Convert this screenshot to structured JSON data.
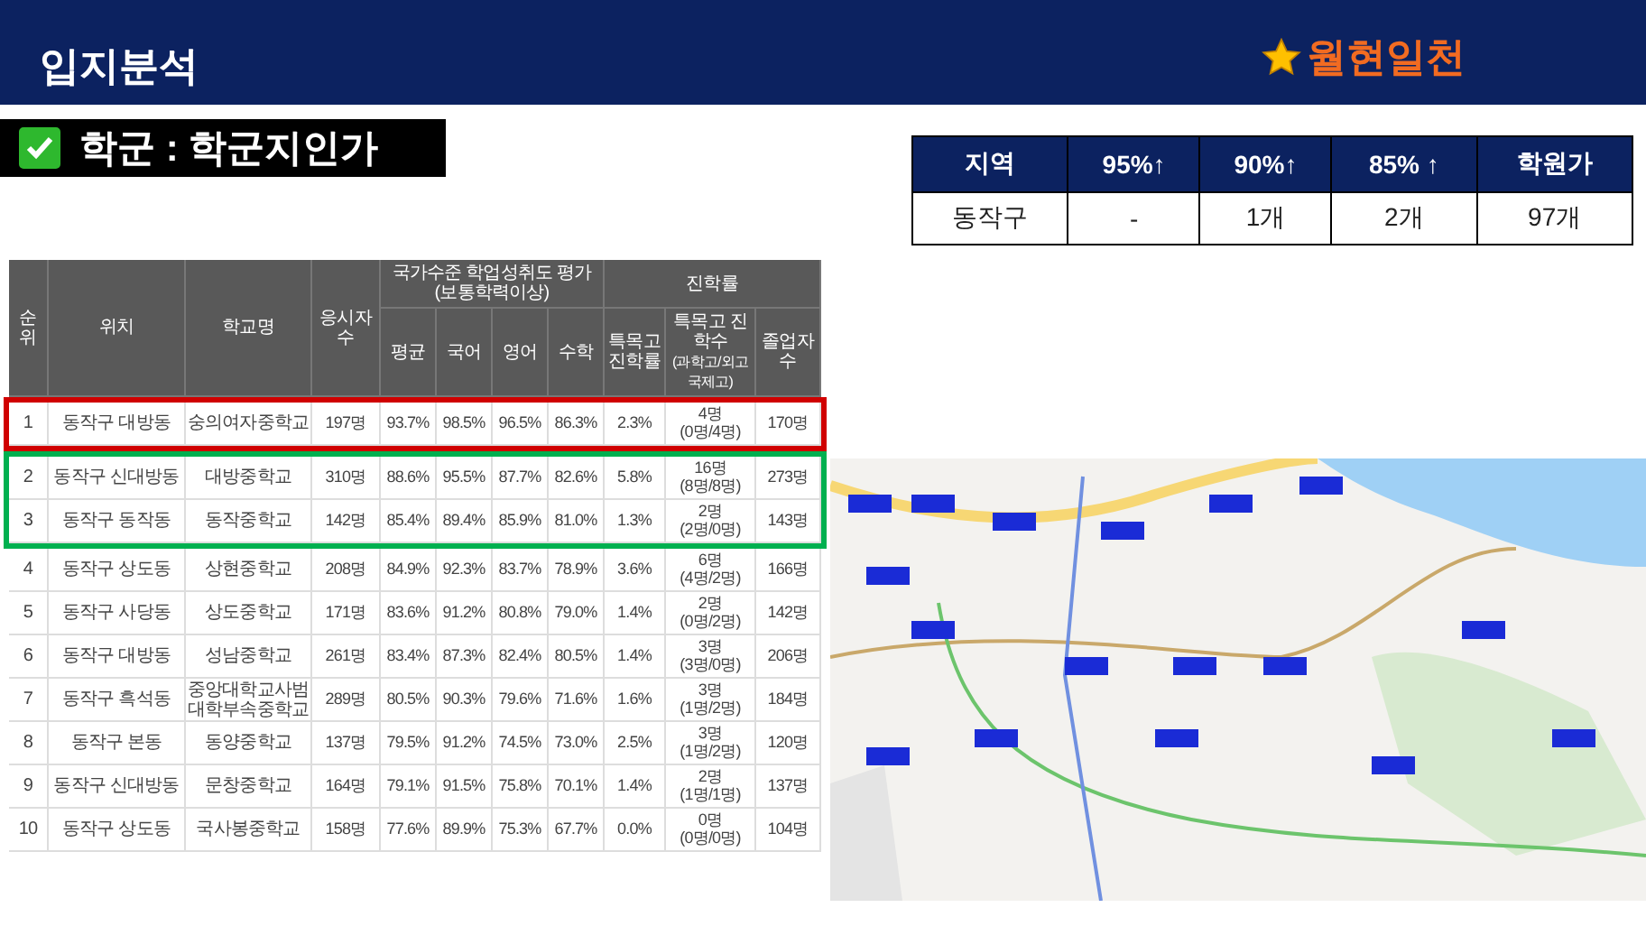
{
  "header": {
    "title": "입지분석",
    "badge": "월현일천"
  },
  "section_label": {
    "text": "학군 : 학군지인가",
    "checked": true
  },
  "summary_table": {
    "columns": [
      "지역",
      "95%↑",
      "90%↑",
      "85% ↑",
      "학원가"
    ],
    "rows": [
      [
        "동작구",
        "-",
        "1개",
        "2개",
        "97개"
      ]
    ]
  },
  "school_table": {
    "header": {
      "rank": "순위",
      "location": "위치",
      "school": "학교명",
      "test_takers": "응시자수",
      "assessment": "국가수준 학업성취도 평가 (보통학력이상)",
      "average": "평균",
      "korean": "국어",
      "english": "영어",
      "math": "수학",
      "advancement": "진학률",
      "special_rate": "특목고 진학률",
      "special_count": "특목고 진학수",
      "special_note": "(과학고/외고국제고)",
      "graduates": "졸업자수"
    },
    "groups": [
      {
        "color": "#d00000",
        "rows": [
          {
            "rank": "1",
            "location": "동작구 대방동",
            "school": "숭의여자중학교",
            "test_takers": "197명",
            "average": "93.7%",
            "korean": "98.5%",
            "english": "96.5%",
            "math": "86.3%",
            "special_rate": "2.3%",
            "special_count": "4명",
            "special_breakdown": "(0명/4명)",
            "graduates": "170명"
          }
        ]
      },
      {
        "color": "#00b050",
        "rows": [
          {
            "rank": "2",
            "location": "동작구 신대방동",
            "school": "대방중학교",
            "test_takers": "310명",
            "average": "88.6%",
            "korean": "95.5%",
            "english": "87.7%",
            "math": "82.6%",
            "special_rate": "5.8%",
            "special_count": "16명",
            "special_breakdown": "(8명/8명)",
            "graduates": "273명"
          },
          {
            "rank": "3",
            "location": "동작구 동작동",
            "school": "동작중학교",
            "test_takers": "142명",
            "average": "85.4%",
            "korean": "89.4%",
            "english": "85.9%",
            "math": "81.0%",
            "special_rate": "1.3%",
            "special_count": "2명",
            "special_breakdown": "(2명/0명)",
            "graduates": "143명"
          }
        ]
      },
      {
        "rows": [
          {
            "rank": "4",
            "location": "동작구 상도동",
            "school": "상현중학교",
            "test_takers": "208명",
            "average": "84.9%",
            "korean": "92.3%",
            "english": "83.7%",
            "math": "78.9%",
            "special_rate": "3.6%",
            "special_count": "6명",
            "special_breakdown": "(4명/2명)",
            "graduates": "166명"
          },
          {
            "rank": "5",
            "location": "동작구 사당동",
            "school": "상도중학교",
            "test_takers": "171명",
            "average": "83.6%",
            "korean": "91.2%",
            "english": "80.8%",
            "math": "79.0%",
            "special_rate": "1.4%",
            "special_count": "2명",
            "special_breakdown": "(0명/2명)",
            "graduates": "142명"
          },
          {
            "rank": "6",
            "location": "동작구 대방동",
            "school": "성남중학교",
            "test_takers": "261명",
            "average": "83.4%",
            "korean": "87.3%",
            "english": "82.4%",
            "math": "80.5%",
            "special_rate": "1.4%",
            "special_count": "3명",
            "special_breakdown": "(3명/0명)",
            "graduates": "206명"
          },
          {
            "rank": "7",
            "location": "동작구 흑석동",
            "school": "중앙대학교사범대학부속중학교",
            "test_takers": "289명",
            "average": "80.5%",
            "korean": "90.3%",
            "english": "79.6%",
            "math": "71.6%",
            "special_rate": "1.6%",
            "special_count": "3명",
            "special_breakdown": "(1명/2명)",
            "graduates": "184명"
          },
          {
            "rank": "8",
            "location": "동작구 본동",
            "school": "동양중학교",
            "test_takers": "137명",
            "average": "79.5%",
            "korean": "91.2%",
            "english": "74.5%",
            "math": "73.0%",
            "special_rate": "2.5%",
            "special_count": "3명",
            "special_breakdown": "(1명/2명)",
            "graduates": "120명"
          },
          {
            "rank": "9",
            "location": "동작구 신대방동",
            "school": "문창중학교",
            "test_takers": "164명",
            "average": "79.1%",
            "korean": "91.5%",
            "english": "75.8%",
            "math": "70.1%",
            "special_rate": "1.4%",
            "special_count": "2명",
            "special_breakdown": "(1명/1명)",
            "graduates": "137명"
          },
          {
            "rank": "10",
            "location": "동작구 상도동",
            "school": "국사봉중학교",
            "test_takers": "158명",
            "average": "77.6%",
            "korean": "89.9%",
            "english": "75.3%",
            "math": "67.7%",
            "special_rate": "0.0%",
            "special_count": "0명",
            "special_breakdown": "(0명/0명)",
            "graduates": "104명"
          }
        ]
      }
    ]
  }
}
